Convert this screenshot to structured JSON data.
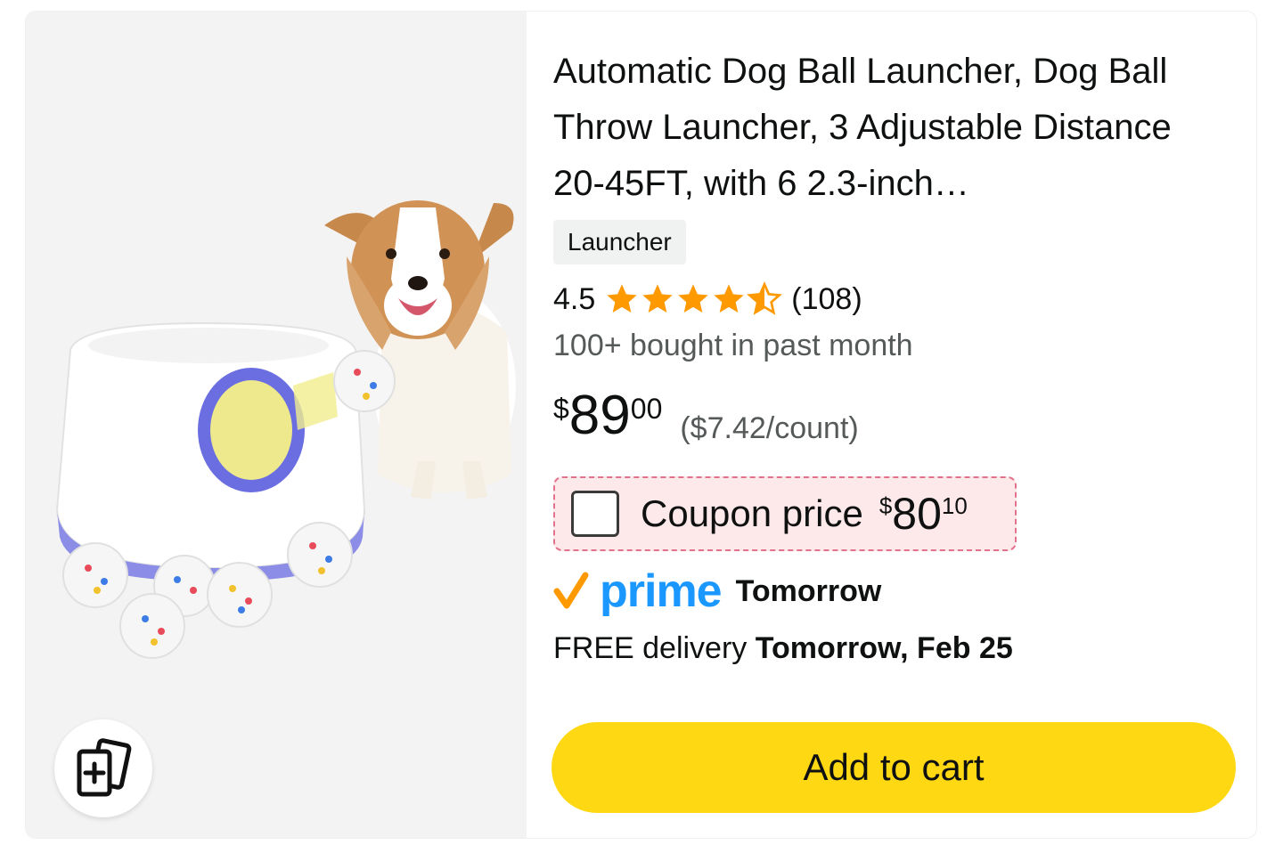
{
  "product": {
    "title": "Automatic Dog Ball Launcher, Dog Ball Throw Launcher, 3 Adjustable Distance 20-45FT, with 6 2.3-inch…",
    "variant": "Launcher",
    "rating": "4.5",
    "rating_stars": 4.5,
    "rating_count": "(108)",
    "bought": "100+ bought in past month",
    "price": {
      "symbol": "$",
      "whole": "89",
      "fraction": "00"
    },
    "unit_price": "($7.42/count)",
    "coupon": {
      "label": "Coupon price",
      "symbol": "$",
      "whole": "80",
      "fraction": "10"
    },
    "prime": {
      "word": "prime",
      "when": "Tomorrow"
    },
    "delivery": {
      "prefix": "FREE delivery ",
      "date": "Tomorrow, Feb 25"
    },
    "add_to_cart": "Add to cart"
  },
  "icons": {
    "compare": "compare-cards-icon",
    "star": "star-icon",
    "prime_check": "prime-check-icon"
  },
  "colors": {
    "star": "#ff9900",
    "prime_blue": "#1a98ff",
    "prime_check": "#ff9900",
    "button": "#ffd814",
    "coupon_bg": "#fde8ea",
    "coupon_border": "#e2718a"
  }
}
